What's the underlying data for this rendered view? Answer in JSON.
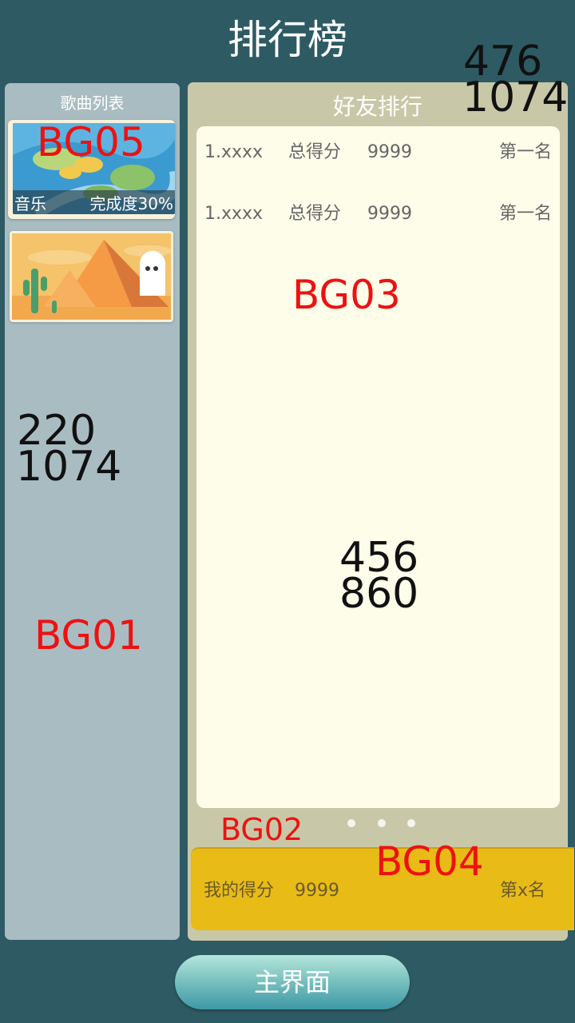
{
  "page": {
    "title": "排行榜"
  },
  "left_panel": {
    "header": "歌曲列表",
    "songs": [
      {
        "caption_left": "音乐",
        "caption_right": "完成度30%",
        "art": "lily-pad-pond"
      },
      {
        "art": "desert-pyramid-cactus"
      }
    ]
  },
  "right_panel": {
    "header": "好友排行",
    "rows": [
      {
        "name": "1.xxxx",
        "score_label": "总得分",
        "score": "9999",
        "place": "第一名"
      },
      {
        "name": "1.xxxx",
        "score_label": "总得分",
        "score": "9999",
        "place": "第一名"
      }
    ],
    "page_dots": 3,
    "my_score": {
      "label": "我的得分",
      "score": "9999",
      "place": "第x名"
    }
  },
  "main_button": {
    "label": "主界面"
  },
  "annotations": {
    "bg01": "BG01",
    "bg02": "BG02",
    "bg03": "BG03",
    "bg04": "BG04",
    "bg05": "BG05",
    "size_right_a": "476",
    "size_right_b": "1074",
    "size_left_a": "220",
    "size_left_b": "1074",
    "size_list_a": "456",
    "size_list_b": "860"
  },
  "colors": {
    "background": "#2e5a63",
    "left_panel": "#a9bcc2",
    "right_panel": "#c8c8a8",
    "list_box": "#fefdea",
    "my_score_bar": "#e8bb16",
    "annotation_red": "#ee1111"
  }
}
